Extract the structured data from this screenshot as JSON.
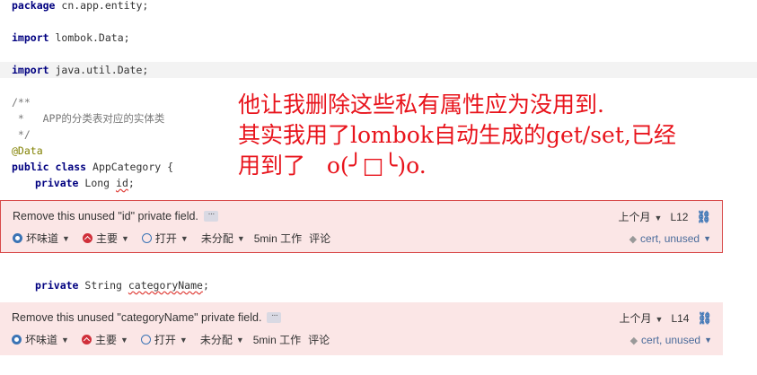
{
  "code": {
    "package_kw": "package",
    "package_name": " cn.app.entity;",
    "import_kw": "import",
    "import1": " lombok.Data;",
    "import2": " java.util.Date;",
    "comment1": "/**",
    "comment2": " *   APP的分类表对应的实体类",
    "comment3": " */",
    "annotation": "@Data",
    "class_kw": "public class",
    "class_name": " AppCategory {",
    "field1_kw": "private",
    "field1_type": " Long ",
    "field1_name": "id",
    "field1_end": ";",
    "field2_kw": "private",
    "field2_type": " String ",
    "field2_name": "categoryName",
    "field2_end": ";"
  },
  "note": {
    "line1": "他让我删除这些私有属性应为没用到.",
    "line2": "其实我用了lombok自动生成的get/set,已经",
    "line3": "用到了   o(╯□╰)o."
  },
  "issues": [
    {
      "message": "Remove this unused \"id\" private field.",
      "more": "···",
      "age": "上个月",
      "line": "L12",
      "type": "坏味道",
      "severity": "主要",
      "status": "打开",
      "assignee": "未分配",
      "effort": "5min 工作",
      "comment": "评论",
      "tags": "cert, unused"
    },
    {
      "message": "Remove this unused \"categoryName\" private field.",
      "more": "···",
      "age": "上个月",
      "line": "L14",
      "type": "坏味道",
      "severity": "主要",
      "status": "打开",
      "assignee": "未分配",
      "effort": "5min 工作",
      "comment": "评论",
      "tags": "cert, unused"
    }
  ],
  "colors": {
    "issue_bg": "#fbe6e6",
    "selected_border": "#d84a4a",
    "note": "#e8141c",
    "link": "#3b74b5"
  }
}
